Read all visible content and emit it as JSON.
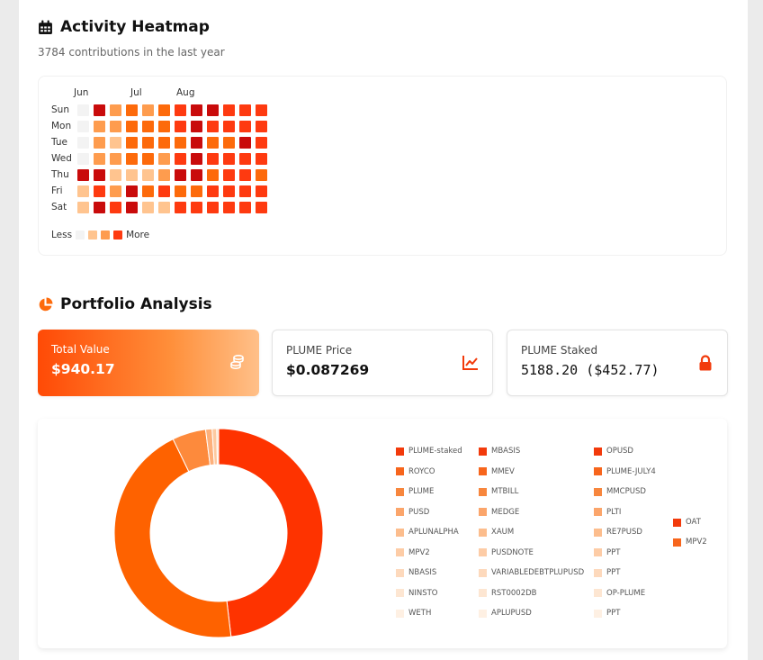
{
  "heatmap": {
    "title": "Activity Heatmap",
    "title_icon": "calendar-icon",
    "subtitle": "3784 contributions in the last year",
    "months": [
      "Jun",
      "Jul",
      "Aug"
    ],
    "days": [
      "Sun",
      "Mon",
      "Tue",
      "Wed",
      "Thu",
      "Fri",
      "Sat"
    ],
    "levels_colors": [
      "#f3f3f3",
      "#ffc48f",
      "#fe9c4e",
      "#fd6a0b",
      "#fe3a10",
      "#c90b0b"
    ],
    "grid": [
      [
        0,
        5,
        2,
        3,
        2,
        3,
        4,
        5,
        5,
        4,
        4,
        4
      ],
      [
        0,
        2,
        2,
        3,
        3,
        3,
        4,
        5,
        4,
        4,
        4,
        4
      ],
      [
        0,
        2,
        1,
        3,
        3,
        3,
        3,
        5,
        3,
        3,
        5,
        4
      ],
      [
        0,
        2,
        2,
        3,
        3,
        2,
        4,
        5,
        4,
        4,
        4,
        4
      ],
      [
        5,
        5,
        1,
        1,
        1,
        2,
        5,
        5,
        3,
        4,
        4,
        3
      ],
      [
        1,
        4,
        2,
        5,
        3,
        4,
        3,
        3,
        4,
        4,
        4,
        4
      ],
      [
        1,
        5,
        4,
        5,
        1,
        1,
        4,
        4,
        4,
        4,
        4,
        4
      ]
    ],
    "legend_less": "Less",
    "legend_more": "More",
    "legend_colors": [
      "#f3f3f3",
      "#ffc48f",
      "#fe9c4e",
      "#fe3a10"
    ]
  },
  "portfolio": {
    "title": "Portfolio Analysis",
    "title_icon": "pie-chart-icon",
    "cards": [
      {
        "label": "Total Value",
        "value": "$940.17",
        "icon": "coins-icon"
      },
      {
        "label": "PLUME Price",
        "value": "$0.087269",
        "icon": "line-chart-icon"
      },
      {
        "label": "PLUME Staked",
        "value": "5188.20 ($452.77)",
        "icon": "lock-icon"
      }
    ]
  },
  "chart_data": {
    "type": "pie",
    "donut": true,
    "slices": [
      {
        "label": "PLUME-staked",
        "value": 48.1,
        "color": "#fe3300"
      },
      {
        "label": "MBASIS",
        "value": 44.7,
        "color": "#fe6200"
      },
      {
        "label": "OPUSD",
        "value": 5.2,
        "color": "#fd8a3c"
      },
      {
        "label": "ROYCO",
        "value": 1.0,
        "color": "#fdb07b"
      },
      {
        "label": "MMEV",
        "value": 0.7,
        "color": "#fdc9a0"
      },
      {
        "label": "PLUME-JULY4",
        "value": 0.3,
        "color": "#fde0c6"
      }
    ],
    "legend": [
      {
        "label": "PLUME-staked",
        "color": "#f23a0b"
      },
      {
        "label": "MBASIS",
        "color": "#f23a0b"
      },
      {
        "label": "OPUSD",
        "color": "#f23a0b"
      },
      {
        "label": "ROYCO",
        "color": "#f7651c"
      },
      {
        "label": "MMEV",
        "color": "#f7651c"
      },
      {
        "label": "PLUME-JULY4",
        "color": "#f7651c"
      },
      {
        "label": "PLUME",
        "color": "#f7863d"
      },
      {
        "label": "MTBILL",
        "color": "#f7863d"
      },
      {
        "label": "MMCPUSD",
        "color": "#f7863d"
      },
      {
        "label": "PUSD",
        "color": "#fba56b"
      },
      {
        "label": "MEDGE",
        "color": "#fba56b"
      },
      {
        "label": "PLTI",
        "color": "#fba56b"
      },
      {
        "label": "APLUNALPHA",
        "color": "#fcbd8d"
      },
      {
        "label": "XAUM",
        "color": "#fcbd8d"
      },
      {
        "label": "RE7PUSD",
        "color": "#fcbd8d"
      },
      {
        "label": "MPV2",
        "color": "#fdcca6"
      },
      {
        "label": "PUSDNOTE",
        "color": "#fdcca6"
      },
      {
        "label": "PPT",
        "color": "#fdcca6"
      },
      {
        "label": "NBASIS",
        "color": "#fdd9bc"
      },
      {
        "label": "VARIABLEDEBTPLUPUSD",
        "color": "#fdd9bc"
      },
      {
        "label": "PPT",
        "color": "#fdd9bc"
      },
      {
        "label": "NINSTO",
        "color": "#fde6d2"
      },
      {
        "label": "RST0002DB",
        "color": "#fde6d2"
      },
      {
        "label": "OP-PLUME",
        "color": "#fde6d2"
      },
      {
        "label": "WETH",
        "color": "#fef0e3"
      },
      {
        "label": "APLUPUSD",
        "color": "#fef0e3"
      },
      {
        "label": "PPT",
        "color": "#fef0e3"
      }
    ],
    "legend_extra": [
      {
        "label": "OAT",
        "color": "#f23a0b"
      },
      {
        "label": "MPV2",
        "color": "#f7651c"
      }
    ]
  }
}
